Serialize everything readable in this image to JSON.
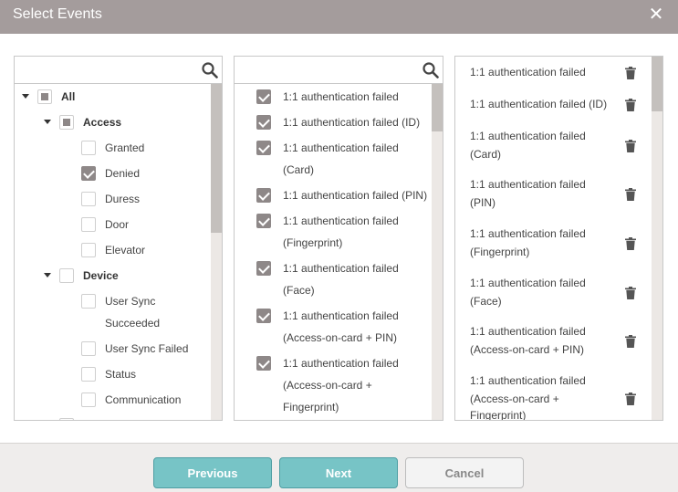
{
  "dialog": {
    "title": "Select Events",
    "close_icon": "close-icon"
  },
  "tree_panel": {
    "search_placeholder": "",
    "search_icon": "search-icon",
    "items": [
      {
        "label": "All",
        "state": "partial",
        "expanded": true
      },
      {
        "label": "Access",
        "state": "partial",
        "expanded": true
      },
      {
        "label": "Granted",
        "state": "unchecked"
      },
      {
        "label": "Denied",
        "state": "checked"
      },
      {
        "label": "Duress",
        "state": "unchecked"
      },
      {
        "label": "Door",
        "state": "unchecked"
      },
      {
        "label": "Elevator",
        "state": "unchecked"
      },
      {
        "label": "Device",
        "state": "unchecked",
        "expanded": true
      },
      {
        "label_line1": "User Sync",
        "label_line2": "Succeeded",
        "state": "unchecked"
      },
      {
        "label": "User Sync Failed",
        "state": "unchecked"
      },
      {
        "label": "Status",
        "state": "unchecked"
      },
      {
        "label": "Communication",
        "state": "unchecked"
      }
    ]
  },
  "event_panel": {
    "search_placeholder": "",
    "search_icon": "search-icon",
    "items": [
      {
        "line1": "1:1 authentication failed",
        "checked": true
      },
      {
        "line1": "1:1 authentication failed (ID)",
        "checked": true
      },
      {
        "line1": "1:1 authentication failed",
        "line2": "(Card)",
        "checked": true
      },
      {
        "line1": "1:1 authentication failed (PIN)",
        "checked": true
      },
      {
        "line1": "1:1 authentication failed",
        "line2": "(Fingerprint)",
        "checked": true
      },
      {
        "line1": "1:1 authentication failed",
        "line2": "(Face)",
        "checked": true
      },
      {
        "line1": "1:1 authentication failed",
        "line2": "(Access-on-card + PIN)",
        "checked": true
      },
      {
        "line1": "1:1 authentication failed",
        "line2": "(Access-on-card +",
        "line3": "Fingerprint)",
        "checked": true
      }
    ]
  },
  "selected_panel": {
    "delete_icon": "trash-icon",
    "items": [
      {
        "line1": "1:1 authentication failed"
      },
      {
        "line1": "1:1 authentication failed (ID)"
      },
      {
        "line1": "1:1 authentication failed",
        "line2": "(Card)"
      },
      {
        "line1": "1:1 authentication failed",
        "line2": "(PIN)"
      },
      {
        "line1": "1:1 authentication failed",
        "line2": "(Fingerprint)"
      },
      {
        "line1": "1:1 authentication failed",
        "line2": "(Face)"
      },
      {
        "line1": "1:1 authentication failed",
        "line2": "(Access-on-card + PIN)"
      },
      {
        "line1": "1:1 authentication failed",
        "line2": "(Access-on-card +",
        "line3": "Fingerprint)"
      }
    ]
  },
  "footer": {
    "previous_label": "Previous",
    "next_label": "Next",
    "cancel_label": "Cancel"
  },
  "colors": {
    "titlebar": "#a49c9c",
    "checkbox_checked": "#8e8888",
    "primary_button": "#77c4c6",
    "footer_bg": "#efedec"
  }
}
